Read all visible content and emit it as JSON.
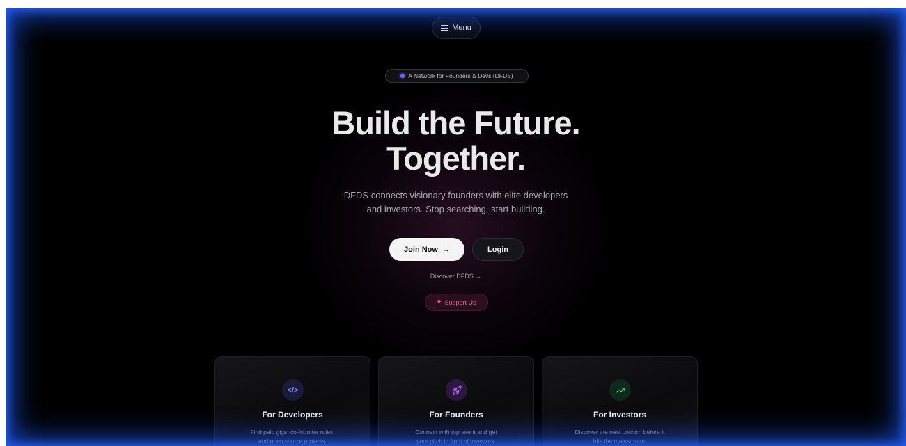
{
  "nav": {
    "menu_label": "Menu"
  },
  "hero": {
    "tag": "A Network for Founders & Devs (DFDS)",
    "title_line1": "Build the Future.",
    "title_line2": "Together.",
    "subtitle_line1": "DFDS connects visionary founders with elite developers",
    "subtitle_line2": "and investors. Stop searching, start building."
  },
  "actions": {
    "join_label": "Join Now",
    "join_arrow": "→",
    "login_label": "Login",
    "discover_label": "Discover DFDS  →",
    "support_label": "Support Us"
  },
  "cards": [
    {
      "icon": "code-icon",
      "glyph": "</>",
      "title": "For Developers",
      "desc_line1": "Find paid gigs, co-founder roles,",
      "desc_line2": "and open source projects."
    },
    {
      "icon": "rocket-icon",
      "glyph": "🚀",
      "title": "For Founders",
      "desc_line1": "Connect with top talent and get",
      "desc_line2": "your pitch in front of investors."
    },
    {
      "icon": "trending-up-icon",
      "glyph": "↗",
      "title": "For Investors",
      "desc_line1": "Discover the next unicorn before it",
      "desc_line2": "hits the mainstream."
    }
  ],
  "colors": {
    "accent_blue": "#1e5aff",
    "support_pink": "#f0569a",
    "background": "#000000"
  }
}
